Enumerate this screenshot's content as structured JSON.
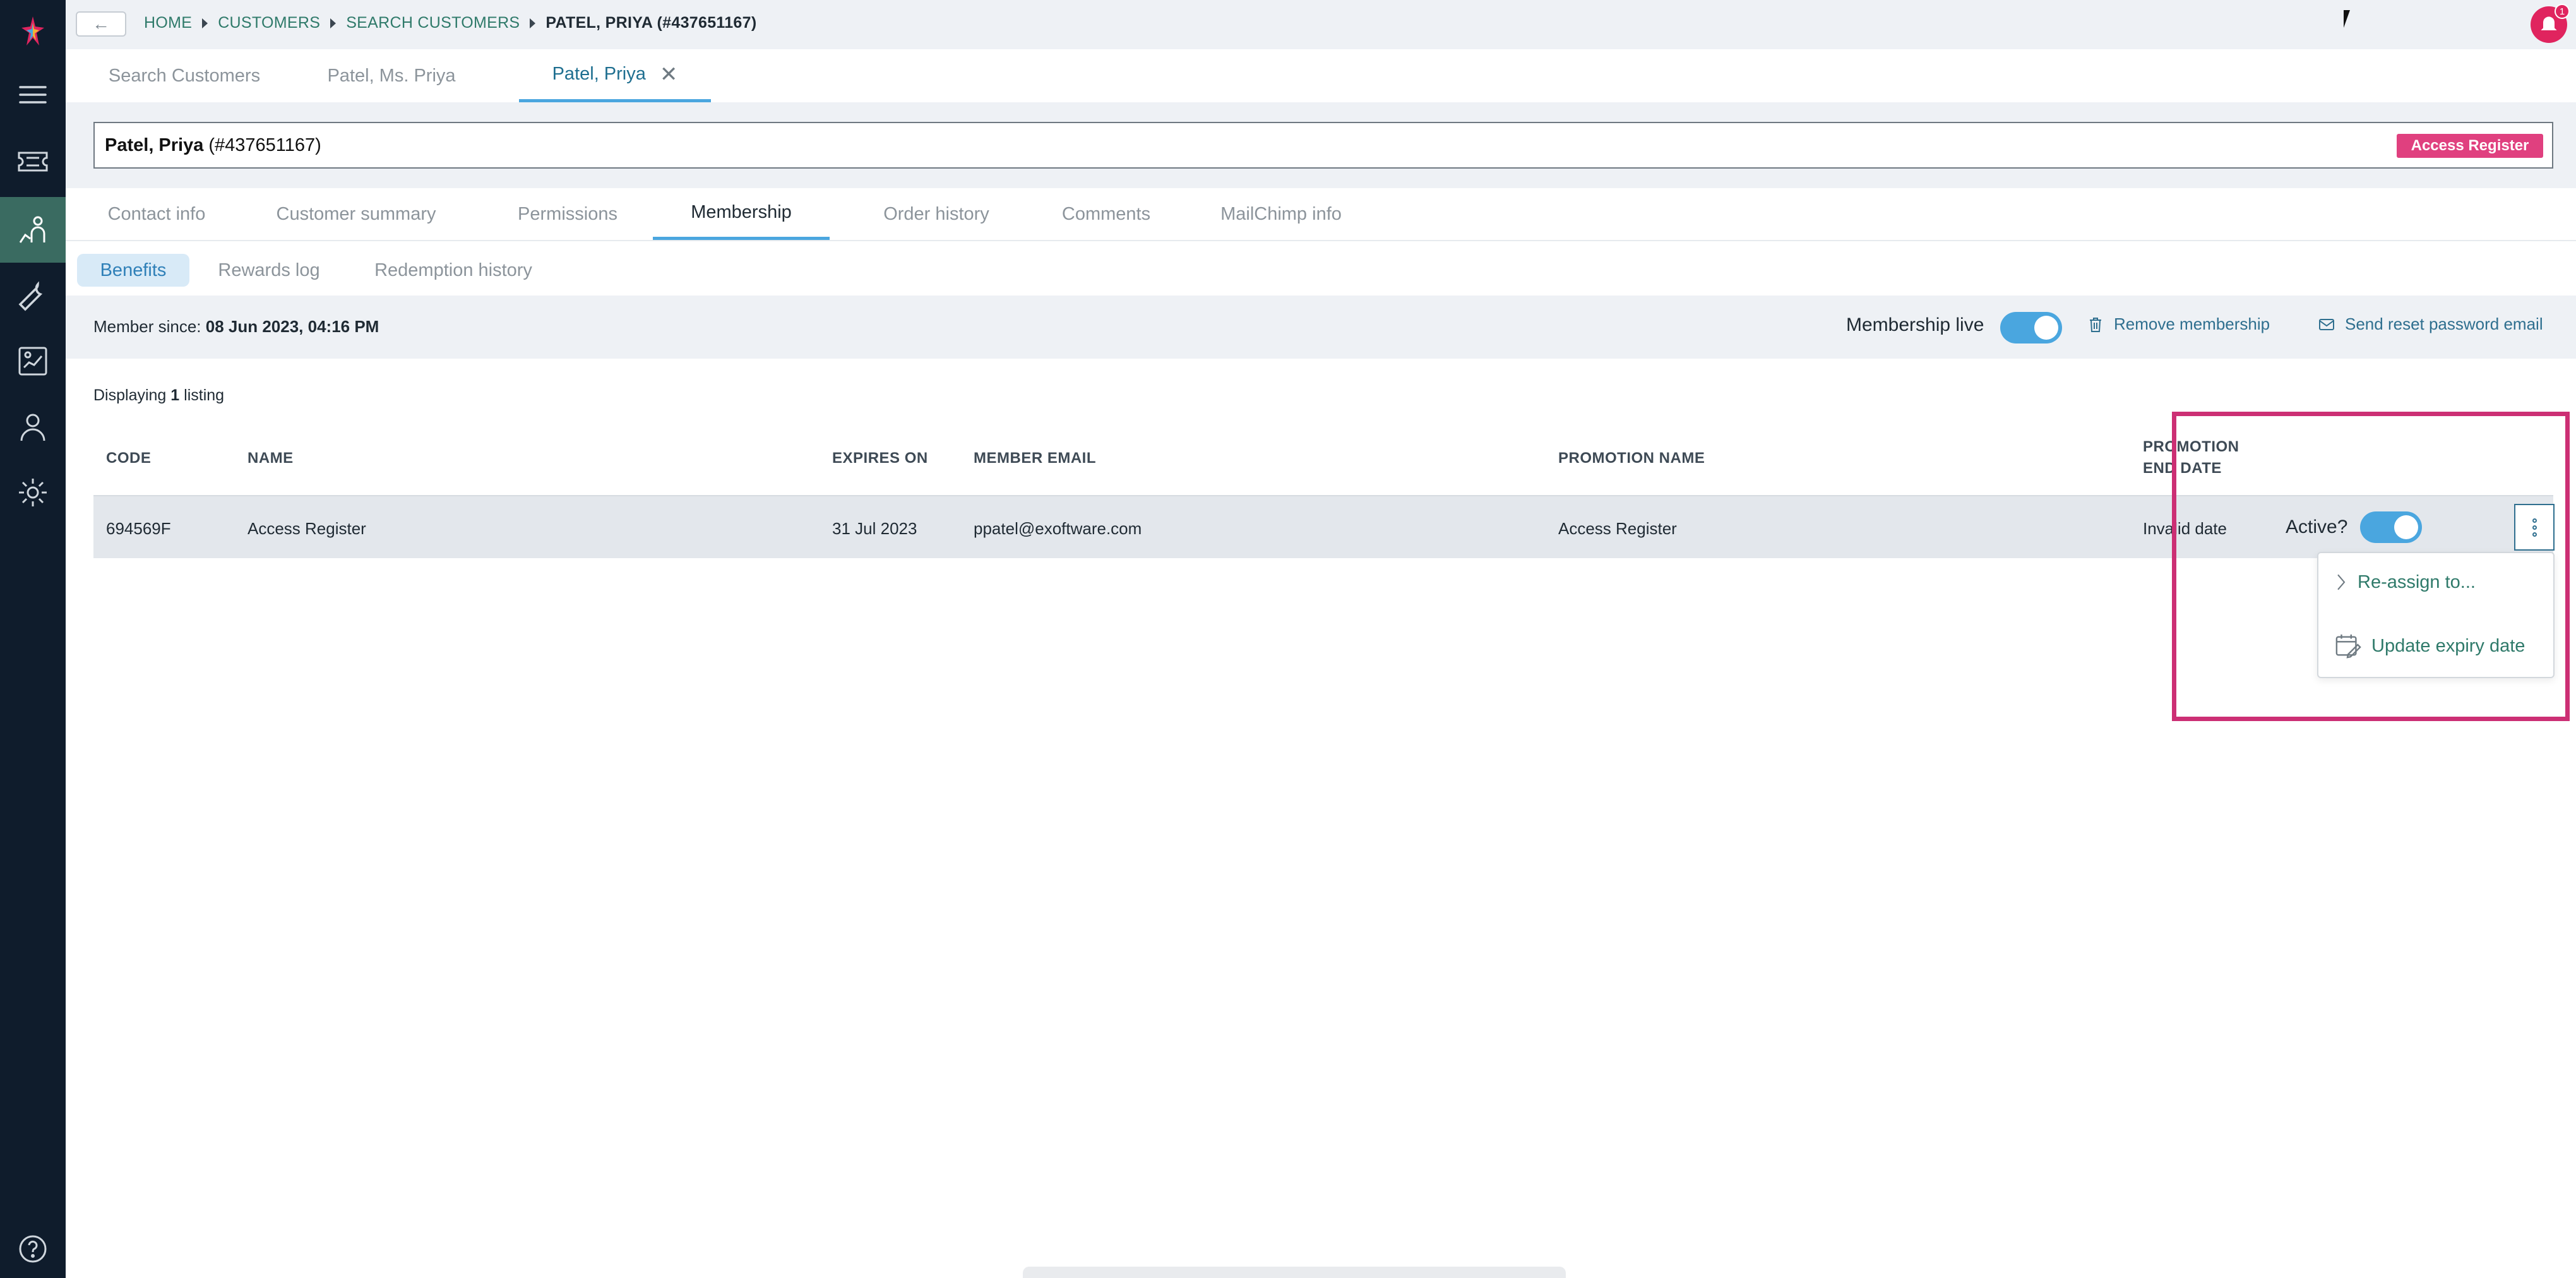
{
  "breadcrumbs": [
    {
      "label": "HOME"
    },
    {
      "label": "CUSTOMERS"
    },
    {
      "label": "SEARCH CUSTOMERS"
    },
    {
      "label": "PATEL, PRIYA (#437651167)"
    }
  ],
  "back_label": "←",
  "notifications": {
    "count": "1"
  },
  "page_tabs": [
    {
      "label": "Search Customers"
    },
    {
      "label": "Patel, Ms. Priya"
    },
    {
      "label": "Patel, Priya",
      "close": "✕"
    }
  ],
  "customer": {
    "name": "Patel, Priya",
    "id": "(#437651167)",
    "badge": "Access Register"
  },
  "section_tabs": [
    {
      "label": "Contact info"
    },
    {
      "label": "Customer summary"
    },
    {
      "label": "Permissions"
    },
    {
      "label": "Membership"
    },
    {
      "label": "Order history"
    },
    {
      "label": "Comments"
    },
    {
      "label": "MailChimp info"
    }
  ],
  "sub_tabs": [
    {
      "label": "Benefits"
    },
    {
      "label": "Rewards log"
    },
    {
      "label": "Redemption history"
    }
  ],
  "member_bar": {
    "since_label": "Member since:",
    "since_value": "08 Jun 2023, 04:16 PM",
    "live_label": "Membership live",
    "remove_label": "Remove membership",
    "reset_label": "Send reset password email"
  },
  "listing": {
    "prefix": "Displaying",
    "count": "1",
    "suffix": "listing"
  },
  "table": {
    "headers": {
      "code": "CODE",
      "name": "NAME",
      "expires": "EXPIRES ON",
      "email": "MEMBER EMAIL",
      "promo": "PROMOTION NAME",
      "promo_end_1": "PROMOTION",
      "promo_end_2": "END DATE"
    },
    "rows": [
      {
        "code": "694569F",
        "name": "Access Register",
        "expires": "31 Jul 2023",
        "email": "ppatel@exoftware.com",
        "promo": "Access Register",
        "promo_end": "Invalid date",
        "active_label": "Active?"
      }
    ]
  },
  "menu": {
    "items": [
      {
        "label": "Re-assign to...",
        "icon": "chevron-right-icon"
      },
      {
        "label": "Update expiry date",
        "icon": "calendar-edit-icon"
      }
    ]
  },
  "colors": {
    "sidebar": "#0f1c2c",
    "accent": "#4aa6df",
    "link": "#2f7a6a",
    "badge": "#e0407f",
    "highlight": "#cc2f74"
  }
}
